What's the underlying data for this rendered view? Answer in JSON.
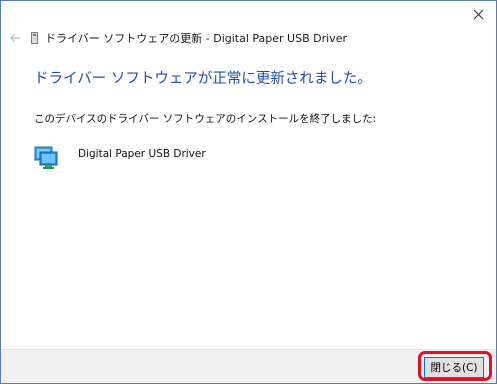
{
  "window": {
    "title": "ドライバー ソフトウェアの更新 - Digital Paper USB Driver",
    "close_icon": "close-icon",
    "back_icon": "back-arrow-icon"
  },
  "content": {
    "heading": "ドライバー ソフトウェアが正常に更新されました。",
    "message": "このデバイスのドライバー ソフトウェアのインストールを終了しました:",
    "device_name": "Digital Paper USB Driver",
    "device_icon": "monitor-device-icon"
  },
  "footer": {
    "close_button_label": "閉じる(C)"
  },
  "colors": {
    "heading": "#1c4fa5",
    "footer_bg": "#f0f0f0",
    "button_border": "#0078d7",
    "highlight": "#e0102b"
  }
}
